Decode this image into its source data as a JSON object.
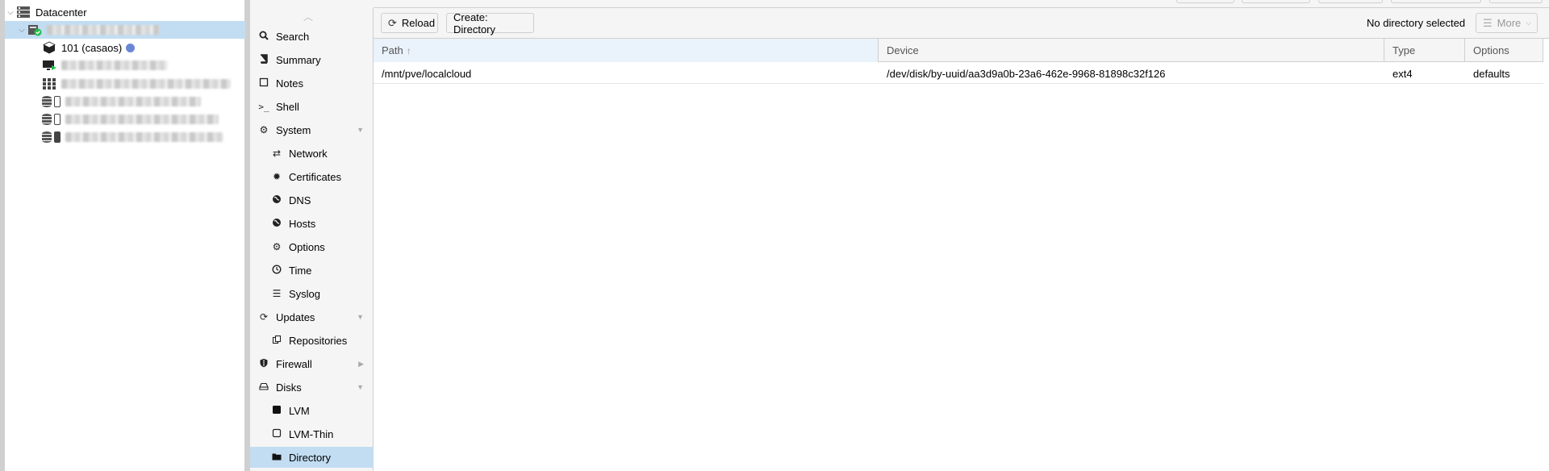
{
  "tree": {
    "datacenter_label": "Datacenter",
    "ct_label": "101 (casaos)"
  },
  "menu": {
    "items": [
      {
        "label": "Search",
        "icon": "search-icon"
      },
      {
        "label": "Summary",
        "icon": "book-icon"
      },
      {
        "label": "Notes",
        "icon": "note-icon"
      },
      {
        "label": "Shell",
        "icon": "terminal-icon"
      },
      {
        "label": "System",
        "icon": "gears-icon"
      },
      {
        "label": "Network",
        "icon": "exchange-icon"
      },
      {
        "label": "Certificates",
        "icon": "certificate-icon"
      },
      {
        "label": "DNS",
        "icon": "globe-icon"
      },
      {
        "label": "Hosts",
        "icon": "globe-icon"
      },
      {
        "label": "Options",
        "icon": "gear-icon"
      },
      {
        "label": "Time",
        "icon": "clock-icon"
      },
      {
        "label": "Syslog",
        "icon": "list-icon"
      },
      {
        "label": "Updates",
        "icon": "refresh-icon"
      },
      {
        "label": "Repositories",
        "icon": "files-icon"
      },
      {
        "label": "Firewall",
        "icon": "shield-icon"
      },
      {
        "label": "Disks",
        "icon": "hdd-icon"
      },
      {
        "label": "LVM",
        "icon": "square-icon"
      },
      {
        "label": "LVM-Thin",
        "icon": "square-outline-icon"
      },
      {
        "label": "Directory",
        "icon": "folder-icon"
      }
    ]
  },
  "toolbar": {
    "reload_label": "Reload",
    "create_label": "Create: Directory",
    "status": "No directory selected",
    "more_label": "More"
  },
  "grid": {
    "columns": [
      "Path",
      "Device",
      "Type",
      "Options"
    ],
    "rows": [
      {
        "path": "/mnt/pve/localcloud",
        "device": "/dev/disk/by-uuid/aa3d9a0b-23a6-462e-9968-81898c32f126",
        "type": "ext4",
        "options": "defaults"
      }
    ]
  },
  "colors": {
    "selection": "#c2ddf2",
    "running_green": "#21bf4b",
    "ct_status_dot": "#6a87d6"
  }
}
